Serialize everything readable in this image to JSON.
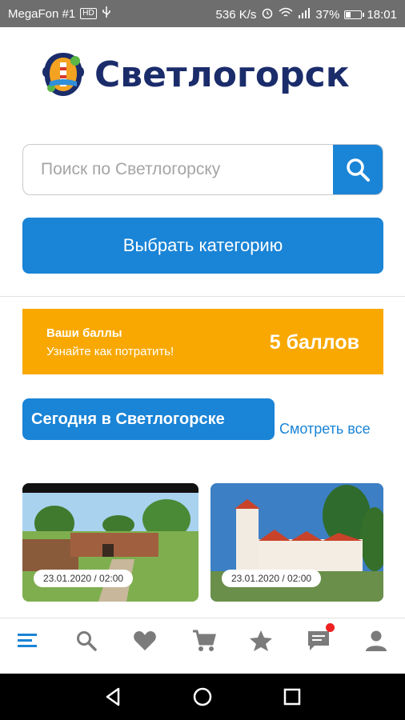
{
  "status_bar": {
    "carrier": "MegaFon #1",
    "network_badge": "HD",
    "speed": "536 K/s",
    "battery": "37%",
    "time": "18:01",
    "icons": [
      "usb-icon",
      "alarm-icon",
      "wifi-icon",
      "signal-icon",
      "battery-icon"
    ]
  },
  "header": {
    "logo_text": "Светлогорск"
  },
  "search": {
    "placeholder": "Поиск по Светлогорску",
    "value": ""
  },
  "category_button": {
    "label": "Выбрать категорию"
  },
  "points": {
    "title": "Ваши баллы",
    "subtitle": "Узнайте как потратить!",
    "value": "5 баллов"
  },
  "today": {
    "label": "Сегодня в Светлогорске",
    "see_all": "Смотреть все"
  },
  "events": [
    {
      "date": "23.01.2020 / 02:00"
    },
    {
      "date": "23.01.2020 / 02:00"
    }
  ],
  "bottom_nav": {
    "items": [
      "menu-icon",
      "search-icon",
      "heart-icon",
      "cart-icon",
      "star-icon",
      "chat-icon",
      "profile-icon"
    ],
    "active": "menu-icon",
    "notification_on": "chat-icon"
  },
  "colors": {
    "primary": "#1a84d6",
    "accent": "#f8a800",
    "logo": "#1b2c6b",
    "status_bar": "#6e6e6e"
  }
}
